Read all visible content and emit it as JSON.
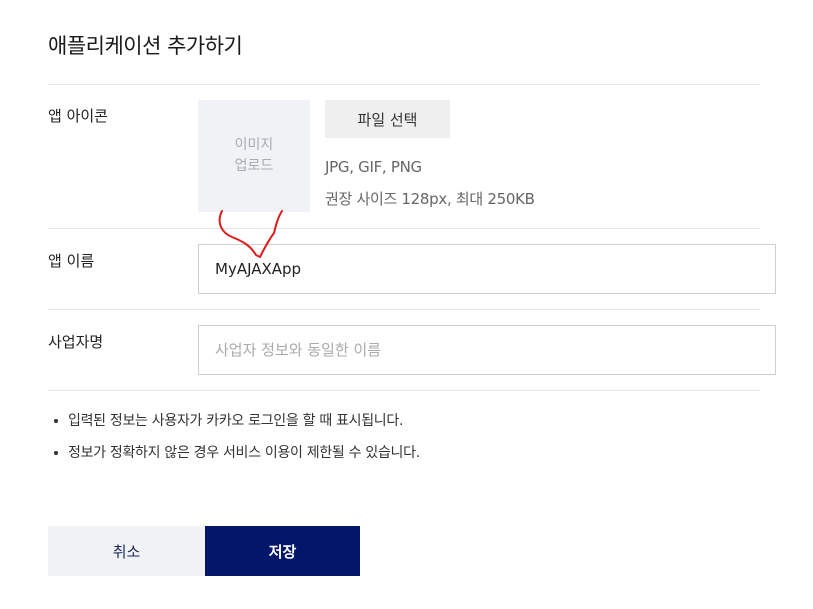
{
  "page": {
    "title": "애플리케이션 추가하기"
  },
  "app_icon": {
    "label": "앱 아이콘",
    "upload_line1": "이미지",
    "upload_line2": "업로드",
    "file_button": "파일 선택",
    "hint_formats": "JPG, GIF, PNG",
    "hint_size": "권장 사이즈 128px, 최대 250KB"
  },
  "app_name": {
    "label": "앱 이름",
    "value": "MyAJAXApp"
  },
  "company": {
    "label": "사업자명",
    "placeholder": "사업자 정보와 동일한 이름"
  },
  "notes": [
    "입력된 정보는 사용자가 카카오 로그인을 할 때 표시됩니다.",
    "정보가 정확하지 않은 경우 서비스 이용이 제한될 수 있습니다."
  ],
  "buttons": {
    "cancel": "취소",
    "save": "저장"
  },
  "colors": {
    "primary": "#04166a",
    "secondary_bg": "#f0f2f6",
    "annotation": "#e01b1b"
  }
}
